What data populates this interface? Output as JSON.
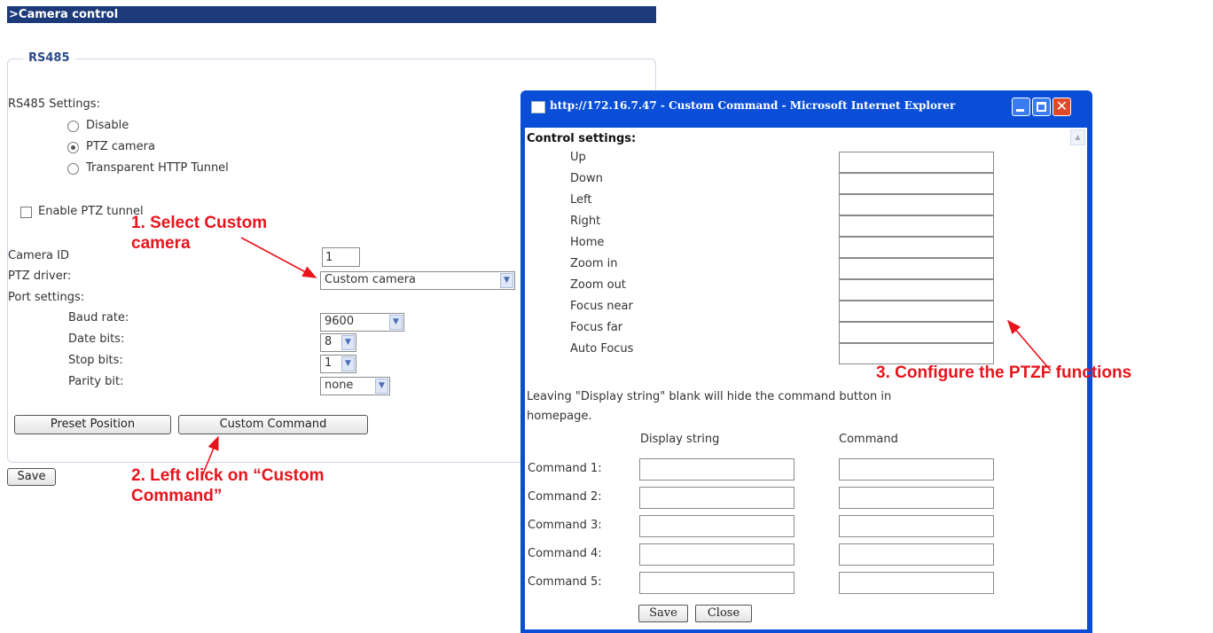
{
  "page_title": "Camera control",
  "section_legend": "RS485",
  "rs485": {
    "settings_label": "RS485 Settings:",
    "options": [
      "Disable",
      "PTZ camera",
      "Transparent HTTP Tunnel"
    ],
    "enable_ptz_tunnel_label": "Enable PTZ tunnel"
  },
  "camera": {
    "camera_id_label": "Camera ID",
    "camera_id_value": "1",
    "ptz_driver_label": "PTZ driver:",
    "ptz_driver_value": "Custom camera",
    "port_settings_label": "Port settings:",
    "baud_rate_label": "Baud rate:",
    "baud_rate_value": "9600",
    "date_bits_label": "Date bits:",
    "date_bits_value": "8",
    "stop_bits_label": "Stop bits:",
    "stop_bits_value": "1",
    "parity_bit_label": "Parity bit:",
    "parity_bit_value": "none"
  },
  "buttons": {
    "preset_position": "Preset Position",
    "custom_command": "Custom Command",
    "save": "Save"
  },
  "annotations": {
    "step1_line1": "1. Select Custom",
    "step1_line2": "camera",
    "step2_line1": "2. Left click on “Custom",
    "step2_line2": "Command”",
    "step3": "3. Configure the PTZF functions",
    "arrow_color": "#e8141c"
  },
  "popup": {
    "title": "http://172.16.7.47 - Custom Command - Microsoft Internet Explorer",
    "control_settings_label": "Control settings:",
    "controls": [
      "Up",
      "Down",
      "Left",
      "Right",
      "Home",
      "Zoom in",
      "Zoom out",
      "Focus near",
      "Focus far",
      "Auto Focus"
    ],
    "note_line1": "Leaving \"Display string\" blank will hide the command button in",
    "note_line2": "homepage.",
    "col_display": "Display string",
    "col_command": "Command",
    "commands": [
      "Command 1:",
      "Command 2:",
      "Command 3:",
      "Command 4:",
      "Command 5:"
    ],
    "save": "Save",
    "close": "Close"
  },
  "colors": {
    "titlebar": "#1c3a7a",
    "ie_frame": "#0a4ed8",
    "annotation": "#e8141c"
  }
}
